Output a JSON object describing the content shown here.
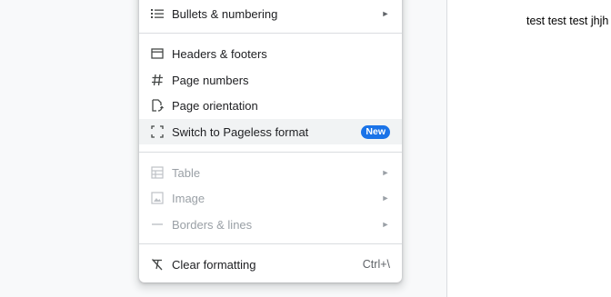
{
  "document": {
    "text": "test test test jhjh"
  },
  "menu": {
    "items": [
      {
        "label": "Bullets & numbering",
        "icon": "bullets-list-icon",
        "submenu": true,
        "disabled": false
      },
      {
        "label": "Headers & footers",
        "icon": "header-footer-icon",
        "submenu": false,
        "disabled": false
      },
      {
        "label": "Page numbers",
        "icon": "hash-icon",
        "submenu": false,
        "disabled": false
      },
      {
        "label": "Page orientation",
        "icon": "page-orientation-icon",
        "submenu": false,
        "disabled": false
      },
      {
        "label": "Switch to Pageless format",
        "icon": "pageless-icon",
        "badge": "New",
        "highlighted": true,
        "disabled": false
      },
      {
        "label": "Table",
        "icon": "table-icon",
        "submenu": true,
        "disabled": true
      },
      {
        "label": "Image",
        "icon": "image-icon",
        "submenu": true,
        "disabled": true
      },
      {
        "label": "Borders & lines",
        "icon": "borders-lines-icon",
        "submenu": true,
        "disabled": true
      },
      {
        "label": "Clear formatting",
        "icon": "clear-formatting-icon",
        "shortcut": "Ctrl+\\",
        "disabled": false
      }
    ],
    "submenu_arrow": "►"
  },
  "colors": {
    "badge_bg": "#1a73e8",
    "highlight_bg": "#f1f3f4",
    "disabled_text": "#9aa0a6"
  }
}
